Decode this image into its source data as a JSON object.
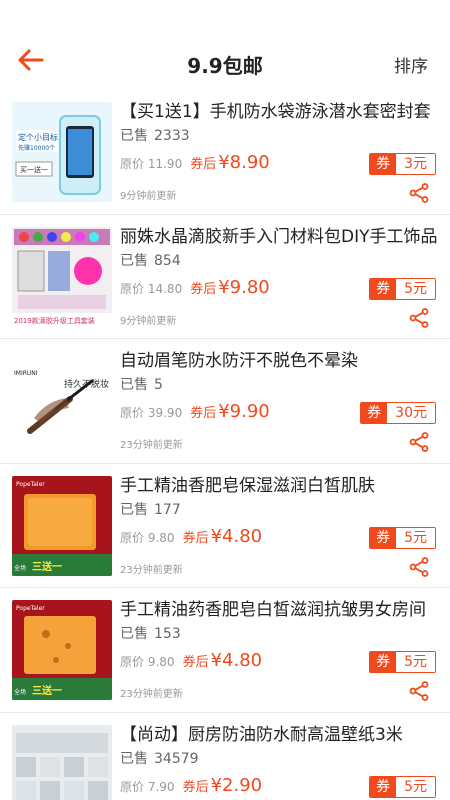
{
  "header": {
    "title": "9.9包邮",
    "sort_label": "排序",
    "accent": "#f04a1c"
  },
  "labels": {
    "sold": "已售",
    "original_price": "原价",
    "after_coupon": "券后",
    "coupon": "券"
  },
  "products": [
    {
      "title": "【买1送1】手机防水袋游泳潜水套密封套",
      "sold": "2333",
      "original_price": "11.90",
      "price": "¥8.90",
      "coupon_value": "3元",
      "updated": "9分钟前更新",
      "thumb_texts": [
        "定个小目标",
        "先赚10000个",
        "买一送一"
      ]
    },
    {
      "title": "丽姝水晶滴胶新手入门材料包DIY手工饰品",
      "sold": "854",
      "original_price": "14.80",
      "price": "¥9.80",
      "coupon_value": "5元",
      "updated": "9分钟前更新",
      "thumb_texts": [
        "2019款滴胶升级工具套装"
      ]
    },
    {
      "title": "自动眉笔防水防汗不脱色不晕染",
      "sold": "5",
      "original_price": "39.90",
      "price": "¥9.90",
      "coupon_value": "30元",
      "updated": "23分钟前更新",
      "thumb_texts": [
        "持久不脱妆",
        "IMIRUNI"
      ]
    },
    {
      "title": "手工精油香肥皂保湿滋润白皙肌肤",
      "sold": "177",
      "original_price": "9.80",
      "price": "¥4.80",
      "coupon_value": "5元",
      "updated": "23分钟前更新",
      "thumb_texts": [
        "PopeTaler",
        "三送一",
        "全场"
      ]
    },
    {
      "title": "手工精油药香肥皂白皙滋润抗皱男女房间",
      "sold": "153",
      "original_price": "9.80",
      "price": "¥4.80",
      "coupon_value": "5元",
      "updated": "23分钟前更新",
      "thumb_texts": [
        "PopeTaler",
        "三送一",
        "全场"
      ]
    },
    {
      "title": "【尚动】厨房防油防水耐高温壁纸3米",
      "sold": "34579",
      "original_price": "7.90",
      "price": "¥2.90",
      "coupon_value": "5元",
      "updated": "",
      "thumb_texts": []
    }
  ]
}
